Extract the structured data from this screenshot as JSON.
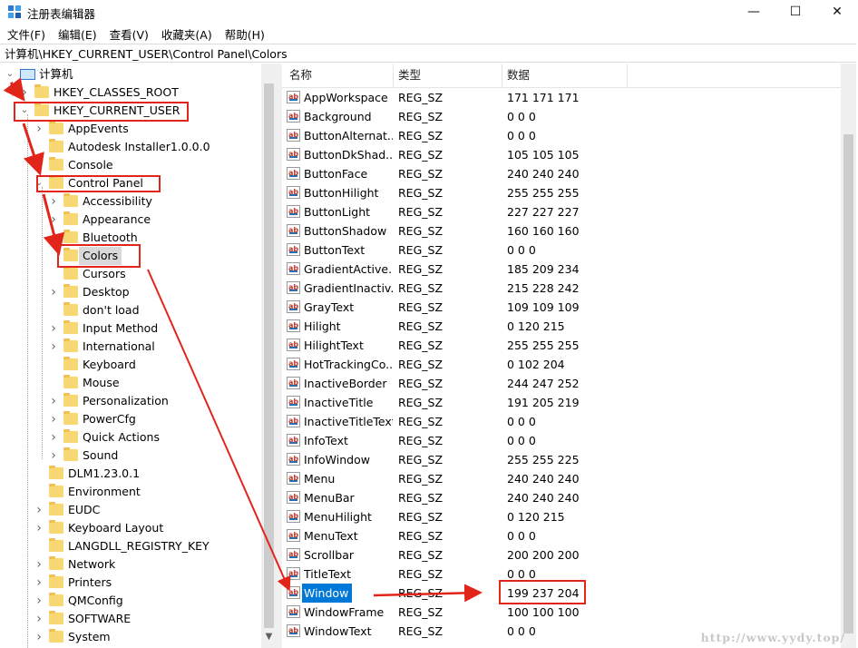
{
  "window": {
    "title": "注册表编辑器",
    "minimize_glyph": "—",
    "maximize_glyph": "☐",
    "close_glyph": "✕"
  },
  "menu": [
    "文件(F)",
    "编辑(E)",
    "查看(V)",
    "收藏夹(A)",
    "帮助(H)"
  ],
  "address": "计算机\\HKEY_CURRENT_USER\\Control Panel\\Colors",
  "tree": [
    {
      "label": "计算机",
      "level": 0,
      "expander": "open",
      "icon": "computer-icon"
    },
    {
      "label": "HKEY_CLASSES_ROOT",
      "level": 1,
      "expander": "closed"
    },
    {
      "label": "HKEY_CURRENT_USER",
      "level": 1,
      "expander": "open"
    },
    {
      "label": "AppEvents",
      "level": 2,
      "expander": "closed"
    },
    {
      "label": "Autodesk Installer1.0.0.0",
      "level": 2,
      "expander": "none"
    },
    {
      "label": "Console",
      "level": 2,
      "expander": "none"
    },
    {
      "label": "Control Panel",
      "level": 2,
      "expander": "open"
    },
    {
      "label": "Accessibility",
      "level": 3,
      "expander": "closed"
    },
    {
      "label": "Appearance",
      "level": 3,
      "expander": "closed"
    },
    {
      "label": "Bluetooth",
      "level": 3,
      "expander": "none"
    },
    {
      "label": "Colors",
      "level": 3,
      "expander": "none",
      "selected": true
    },
    {
      "label": "Cursors",
      "level": 3,
      "expander": "none"
    },
    {
      "label": "Desktop",
      "level": 3,
      "expander": "closed"
    },
    {
      "label": "don't load",
      "level": 3,
      "expander": "none"
    },
    {
      "label": "Input Method",
      "level": 3,
      "expander": "closed"
    },
    {
      "label": "International",
      "level": 3,
      "expander": "closed"
    },
    {
      "label": "Keyboard",
      "level": 3,
      "expander": "none"
    },
    {
      "label": "Mouse",
      "level": 3,
      "expander": "none"
    },
    {
      "label": "Personalization",
      "level": 3,
      "expander": "closed"
    },
    {
      "label": "PowerCfg",
      "level": 3,
      "expander": "closed"
    },
    {
      "label": "Quick Actions",
      "level": 3,
      "expander": "closed"
    },
    {
      "label": "Sound",
      "level": 3,
      "expander": "closed"
    },
    {
      "label": "DLM1.23.0.1",
      "level": 2,
      "expander": "none"
    },
    {
      "label": "Environment",
      "level": 2,
      "expander": "none"
    },
    {
      "label": "EUDC",
      "level": 2,
      "expander": "closed"
    },
    {
      "label": "Keyboard Layout",
      "level": 2,
      "expander": "closed"
    },
    {
      "label": "LANGDLL_REGISTRY_KEY",
      "level": 2,
      "expander": "none"
    },
    {
      "label": "Network",
      "level": 2,
      "expander": "closed"
    },
    {
      "label": "Printers",
      "level": 2,
      "expander": "closed"
    },
    {
      "label": "QMConfig",
      "level": 2,
      "expander": "closed"
    },
    {
      "label": "SOFTWARE",
      "level": 2,
      "expander": "closed"
    },
    {
      "label": "System",
      "level": 2,
      "expander": "closed"
    }
  ],
  "list_header": {
    "name": "名称",
    "type": "类型",
    "data": "数据"
  },
  "value_icon_text": "ab",
  "values": [
    {
      "name": "AppWorkspace",
      "type": "REG_SZ",
      "data": "171 171 171"
    },
    {
      "name": "Background",
      "type": "REG_SZ",
      "data": "0 0 0"
    },
    {
      "name": "ButtonAlternat...",
      "type": "REG_SZ",
      "data": "0 0 0"
    },
    {
      "name": "ButtonDkShad...",
      "type": "REG_SZ",
      "data": "105 105 105"
    },
    {
      "name": "ButtonFace",
      "type": "REG_SZ",
      "data": "240 240 240"
    },
    {
      "name": "ButtonHilight",
      "type": "REG_SZ",
      "data": "255 255 255"
    },
    {
      "name": "ButtonLight",
      "type": "REG_SZ",
      "data": "227 227 227"
    },
    {
      "name": "ButtonShadow",
      "type": "REG_SZ",
      "data": "160 160 160"
    },
    {
      "name": "ButtonText",
      "type": "REG_SZ",
      "data": "0 0 0"
    },
    {
      "name": "GradientActive...",
      "type": "REG_SZ",
      "data": "185 209 234"
    },
    {
      "name": "GradientInactiv...",
      "type": "REG_SZ",
      "data": "215 228 242"
    },
    {
      "name": "GrayText",
      "type": "REG_SZ",
      "data": "109 109 109"
    },
    {
      "name": "Hilight",
      "type": "REG_SZ",
      "data": "0 120 215"
    },
    {
      "name": "HilightText",
      "type": "REG_SZ",
      "data": "255 255 255"
    },
    {
      "name": "HotTrackingCo...",
      "type": "REG_SZ",
      "data": "0 102 204"
    },
    {
      "name": "InactiveBorder",
      "type": "REG_SZ",
      "data": "244 247 252"
    },
    {
      "name": "InactiveTitle",
      "type": "REG_SZ",
      "data": "191 205 219"
    },
    {
      "name": "InactiveTitleText",
      "type": "REG_SZ",
      "data": "0 0 0"
    },
    {
      "name": "InfoText",
      "type": "REG_SZ",
      "data": "0 0 0"
    },
    {
      "name": "InfoWindow",
      "type": "REG_SZ",
      "data": "255 255 225"
    },
    {
      "name": "Menu",
      "type": "REG_SZ",
      "data": "240 240 240"
    },
    {
      "name": "MenuBar",
      "type": "REG_SZ",
      "data": "240 240 240"
    },
    {
      "name": "MenuHilight",
      "type": "REG_SZ",
      "data": "0 120 215"
    },
    {
      "name": "MenuText",
      "type": "REG_SZ",
      "data": "0 0 0"
    },
    {
      "name": "Scrollbar",
      "type": "REG_SZ",
      "data": "200 200 200"
    },
    {
      "name": "TitleText",
      "type": "REG_SZ",
      "data": "0 0 0"
    },
    {
      "name": "Window",
      "type": "REG_SZ",
      "data": "199 237 204",
      "selected": true
    },
    {
      "name": "WindowFrame",
      "type": "REG_SZ",
      "data": "100 100 100"
    },
    {
      "name": "WindowText",
      "type": "REG_SZ",
      "data": "0 0 0"
    }
  ],
  "watermark": "http://www.yydy.top/",
  "colors": {
    "annotation": "#e1251b",
    "selection": "#0078d7",
    "folder": "#f8d775"
  }
}
